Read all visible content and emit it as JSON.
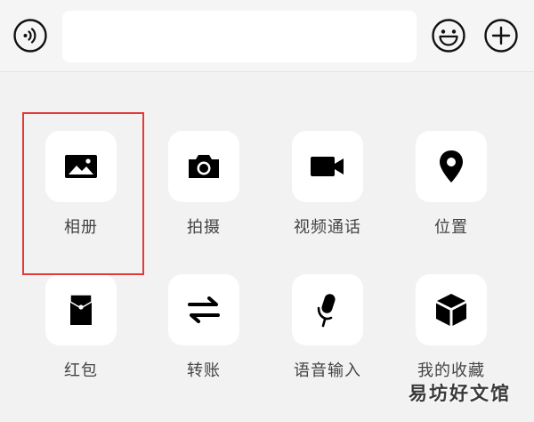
{
  "input_bar": {
    "voice_icon": "voice-icon",
    "text_value": "",
    "emoji_icon": "emoji-icon",
    "plus_icon": "plus-icon"
  },
  "panel": {
    "items": [
      {
        "label": "相册",
        "icon": "photo-album-icon"
      },
      {
        "label": "拍摄",
        "icon": "camera-icon"
      },
      {
        "label": "视频通话",
        "icon": "video-call-icon"
      },
      {
        "label": "位置",
        "icon": "location-pin-icon"
      },
      {
        "label": "红包",
        "icon": "red-packet-icon"
      },
      {
        "label": "转账",
        "icon": "transfer-icon"
      },
      {
        "label": "语音输入",
        "icon": "microphone-icon"
      },
      {
        "label": "我的收藏",
        "icon": "favorites-cube-icon"
      }
    ]
  },
  "highlight": {
    "color": "#e23b3b",
    "target": "相册"
  },
  "watermark": {
    "text": "易坊好文馆"
  }
}
